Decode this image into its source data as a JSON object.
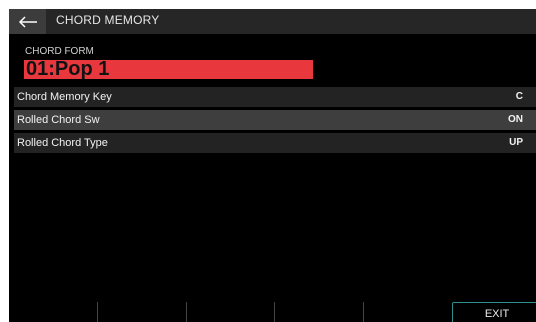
{
  "header": {
    "title": "CHORD MEMORY",
    "back_icon": "arrow-left-icon"
  },
  "chord_form": {
    "label": "CHORD FORM",
    "value": "01:Pop 1",
    "accent_color": "#e8383e"
  },
  "params": [
    {
      "label": "Chord Memory Key",
      "value": "C",
      "selected": false
    },
    {
      "label": "Rolled Chord Sw",
      "value": "ON",
      "selected": true
    },
    {
      "label": "Rolled Chord Type",
      "value": "UP",
      "selected": false
    }
  ],
  "function_keys": {
    "exit_label": "EXIT",
    "exit_color": "#2f8d8d"
  }
}
